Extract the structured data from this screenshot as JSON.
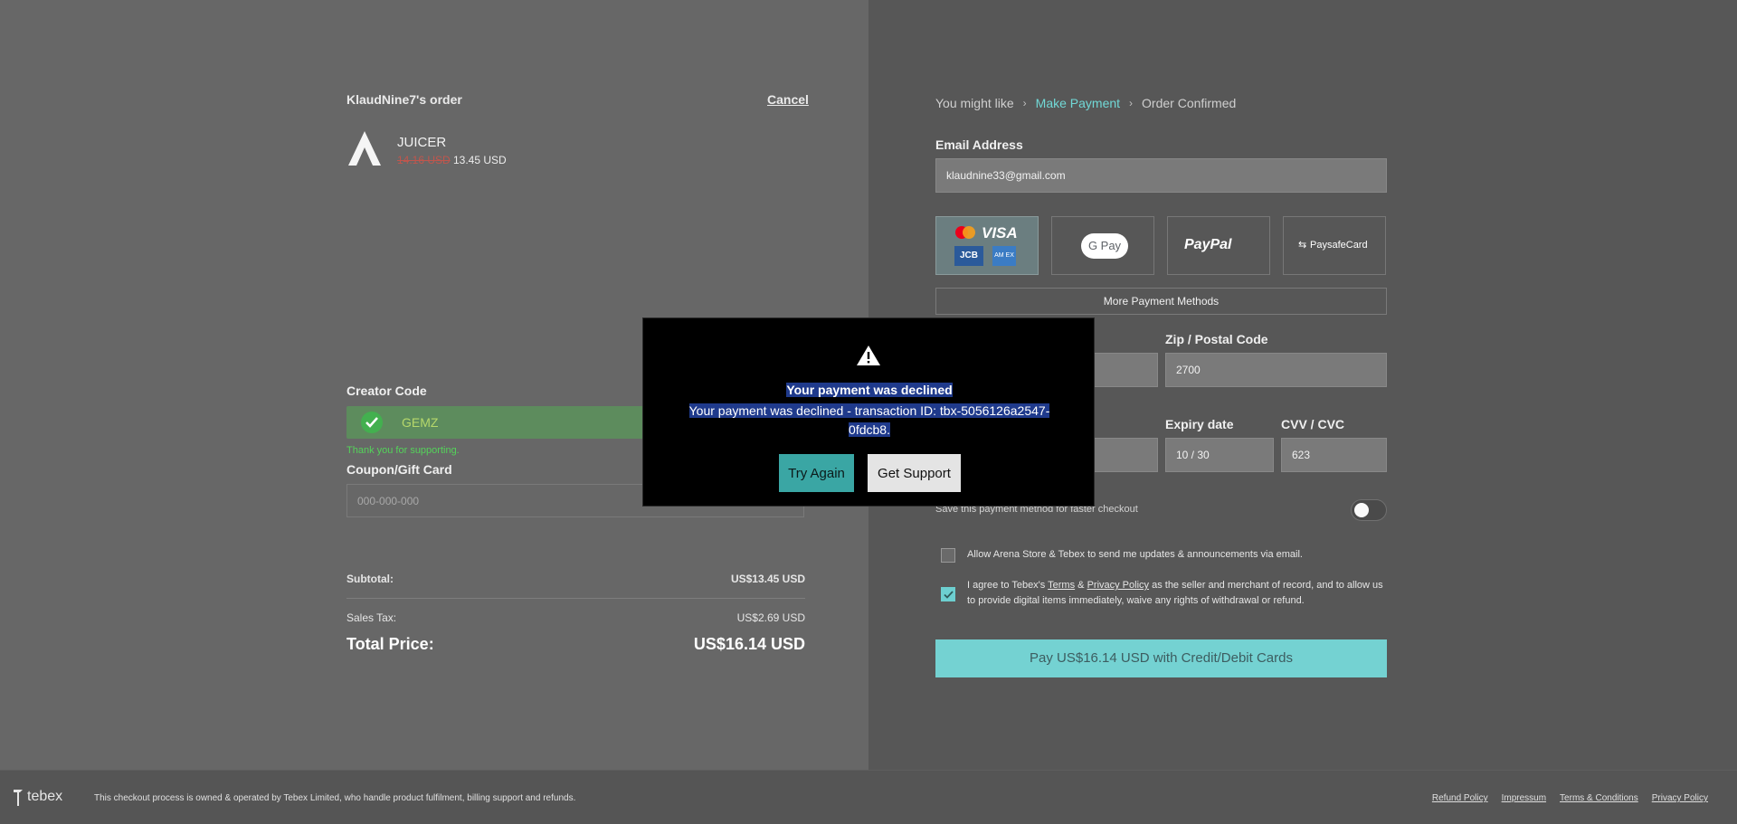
{
  "order": {
    "title": "KlaudNine7's order",
    "cancel_label": "Cancel",
    "product": {
      "name": "JUICER",
      "old_price": "14.16 USD",
      "new_price": "13.45 USD",
      "logo_icon": "triangle-a-logo"
    }
  },
  "creator_code": {
    "label": "Creator Code",
    "value": "GEMZ",
    "thanks": "Thank you for supporting."
  },
  "coupon": {
    "label": "Coupon/Gift Card",
    "placeholder": "000-000-000"
  },
  "summary": {
    "subtotal_label": "Subtotal:",
    "subtotal_value": "US$13.45 USD",
    "tax_label": "Sales Tax:",
    "tax_value": "US$2.69 USD",
    "total_label": "Total Price:",
    "total_value": "US$16.14 USD"
  },
  "breadcrumb": {
    "items": [
      "You might like",
      "Make Payment",
      "Order Confirmed"
    ],
    "active_index": 1
  },
  "email": {
    "label": "Email Address",
    "value": "klaudnine33@gmail.com"
  },
  "payment_methods": {
    "cards_icons": [
      "mastercard-icon",
      "visa-icon",
      "jcb-icon",
      "amex-icon"
    ],
    "visa_label": "VISA",
    "jcb_label": "JCB",
    "amex_label": "AM EX",
    "gpay_label": "G Pay",
    "paypal_label": "PayPal",
    "paysafe_label": "PaysafeCard",
    "more_label": "More Payment Methods"
  },
  "zip": {
    "label": "Zip / Postal Code",
    "value": "2700"
  },
  "expiry": {
    "label": "Expiry date",
    "value": "10 / 30"
  },
  "cvv": {
    "label": "CVV / CVC",
    "value": "623"
  },
  "save_method": {
    "label": "Save this payment method for faster checkout",
    "enabled": false
  },
  "consent": {
    "updates_label": "Allow Arena Store & Tebex to send me updates & announcements via email.",
    "agree_prefix": "I agree to Tebex's ",
    "terms_link": "Terms",
    "amp": " & ",
    "privacy_link": "Privacy Policy",
    "agree_suffix": " as the seller and merchant of record, and to allow us to provide digital items immediately, waive any rights of withdrawal or refund.",
    "agree_checked": true,
    "updates_checked": false
  },
  "pay_button": "Pay US$16.14 USD with Credit/Debit Cards",
  "footer": {
    "brand": "tebex",
    "notice": "This checkout process is owned & operated by Tebex Limited, who handle product fulfilment, billing support and refunds.",
    "links": [
      "Refund Policy",
      "Impressum",
      "Terms & Conditions",
      "Privacy Policy"
    ]
  },
  "modal": {
    "title": "Your payment was declined",
    "message_line1": "Your payment was declined - transaction ID: tbx-5056126a2547-",
    "message_line2": "0fdcb8.",
    "try_again": "Try Again",
    "get_support": "Get Support"
  },
  "colors": {
    "accent": "#74d2d2",
    "success": "#43b04f",
    "error": "#c0564d",
    "selection": "#1f3a8c"
  }
}
